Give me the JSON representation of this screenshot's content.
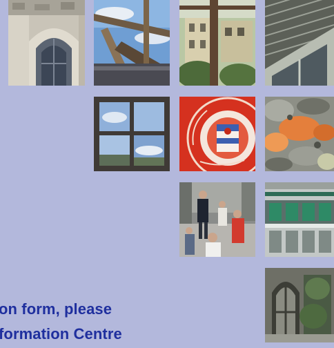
{
  "tiles": [
    {
      "subject": "stone-arch-window"
    },
    {
      "subject": "timber-frame-sky"
    },
    {
      "subject": "building-through-frame"
    },
    {
      "subject": "louvred-facade"
    },
    {
      "subject": "window-reflection"
    },
    {
      "subject": "reading-school-crest"
    },
    {
      "subject": "orange-lichen-stone"
    },
    {
      "subject": "students-walking"
    },
    {
      "subject": "modern-glass-building"
    },
    {
      "subject": "gothic-window"
    }
  ],
  "text": {
    "line1": "on form, please",
    "line2": "formation Centre"
  },
  "colors": {
    "background": "#b3b8dc",
    "text": "#1f2f9e",
    "crest_red": "#d5311f"
  }
}
